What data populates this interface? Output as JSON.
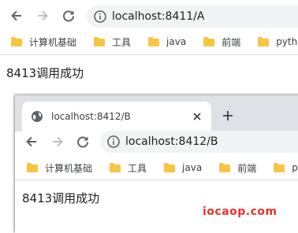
{
  "outer": {
    "url": "localhost:8411/A",
    "bookmarks": [
      {
        "label": "计算机基础",
        "icon": "folder-icon"
      },
      {
        "label": "工具",
        "icon": "folder-icon"
      },
      {
        "label": "java",
        "icon": "folder-icon"
      },
      {
        "label": "前端",
        "icon": "folder-icon"
      },
      {
        "label": "python",
        "icon": "folder-icon"
      }
    ],
    "content": "8413调用成功"
  },
  "inner": {
    "tab_title": "localhost:8412/B",
    "url": "localhost:8412/B",
    "bookmarks": [
      {
        "label": "计算机基础",
        "icon": "folder-icon"
      },
      {
        "label": "工具",
        "icon": "folder-icon"
      },
      {
        "label": "java",
        "icon": "folder-icon"
      },
      {
        "label": "前端",
        "icon": "folder-icon"
      },
      {
        "label": "pytho",
        "icon": "folder-icon"
      }
    ],
    "content": "8413调用成功"
  },
  "watermark": "iocaop.com",
  "colors": {
    "folder": "#f6c544",
    "omnibox": "#f1f3f4",
    "tabstrip": "#dee1e6",
    "watermark": "#e8312e"
  }
}
